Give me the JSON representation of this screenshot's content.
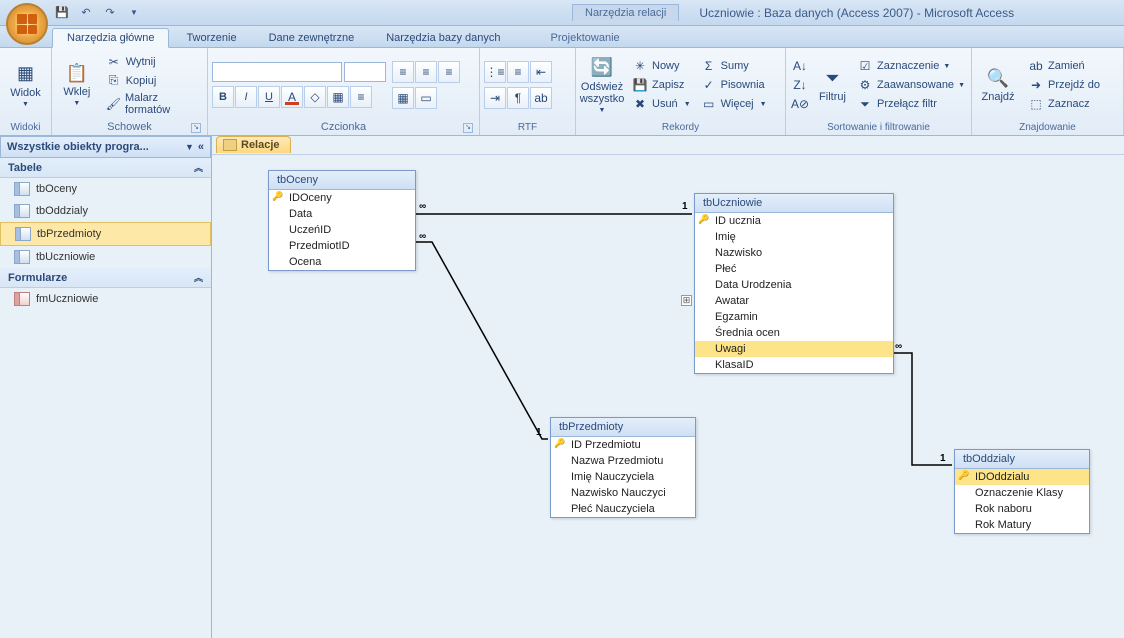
{
  "title": {
    "context_tab": "Narzędzia relacji",
    "window": "Uczniowie : Baza danych (Access 2007) - Microsoft Access"
  },
  "tabs": {
    "home": "Narzędzia główne",
    "create": "Tworzenie",
    "external": "Dane zewnętrzne",
    "dbtools": "Narzędzia bazy danych",
    "design": "Projektowanie"
  },
  "ribbon": {
    "views": {
      "label": "Widoki",
      "widok": "Widok"
    },
    "clipboard": {
      "label": "Schowek",
      "paste": "Wklej",
      "cut": "Wytnij",
      "copy": "Kopiuj",
      "painter": "Malarz formatów"
    },
    "font": {
      "label": "Czcionka"
    },
    "rtf": {
      "label": "RTF"
    },
    "records": {
      "label": "Rekordy",
      "refresh": "Odśwież wszystko",
      "new": "Nowy",
      "save": "Zapisz",
      "delete": "Usuń",
      "sums": "Sumy",
      "spell": "Pisownia",
      "more": "Więcej"
    },
    "sortfilter": {
      "label": "Sortowanie i filtrowanie",
      "filter": "Filtruj",
      "selection": "Zaznaczenie",
      "advanced": "Zaawansowane",
      "toggle": "Przełącz filtr"
    },
    "find": {
      "label": "Znajdowanie",
      "find": "Znajdź",
      "replace": "Zamień",
      "goto": "Przejdź do",
      "select": "Zaznacz"
    }
  },
  "nav": {
    "header": "Wszystkie obiekty progra...",
    "sections": {
      "tables": "Tabele",
      "forms": "Formularze"
    },
    "tables": [
      "tbOceny",
      "tbOddzialy",
      "tbPrzedmioty",
      "tbUczniowie"
    ],
    "selected_table_index": 2,
    "forms": [
      "fmUczniowie"
    ]
  },
  "doc_tab": "Relacje",
  "tables_rel": {
    "tbOceny": {
      "title": "tbOceny",
      "fields": [
        "IDOceny",
        "Data",
        "UczeńID",
        "PrzedmiotID",
        "Ocena"
      ],
      "key": 0
    },
    "tbUczniowie": {
      "title": "tbUczniowie",
      "fields": [
        "ID ucznia",
        "Imię",
        "Nazwisko",
        "Płeć",
        "Data Urodzenia",
        "Awatar",
        "Egzamin",
        "Średnia ocen",
        "Uwagi",
        "KlasaID"
      ],
      "key": 0,
      "selected": 8
    },
    "tbPrzedmioty": {
      "title": "tbPrzedmioty",
      "fields": [
        "ID Przedmiotu",
        "Nazwa Przedmiotu",
        "Imię Nauczyciela",
        "Nazwisko Nauczyci",
        "Płeć Nauczyciela"
      ],
      "key": 0
    },
    "tbOddzialy": {
      "title": "tbOddzialy",
      "fields": [
        "IDOddzialu",
        "Oznaczenie Klasy",
        "Rok naboru",
        "Rok Matury"
      ],
      "key": 0,
      "selected": 0
    }
  }
}
